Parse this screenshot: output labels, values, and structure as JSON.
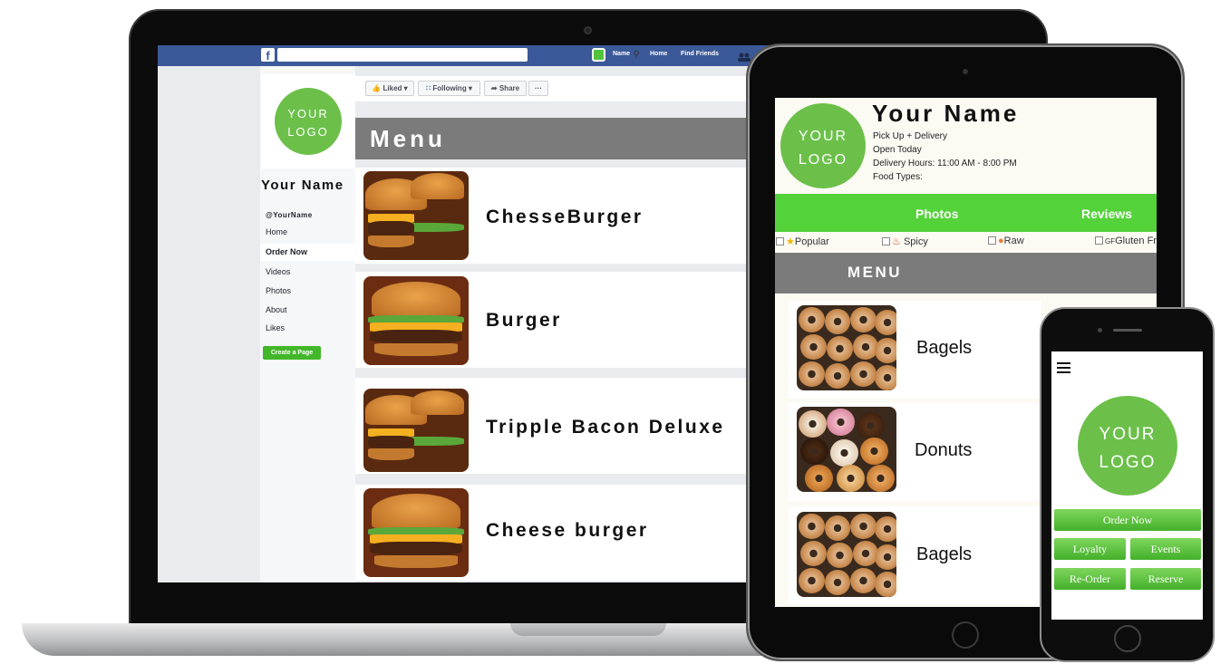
{
  "laptop": {
    "topbar": {
      "logo": "f",
      "search_placeholder": "",
      "search_icon": "search-icon",
      "nav_items": [
        "Name",
        "Home",
        "Find Friends"
      ]
    },
    "sidebar": {
      "logo_line1": "YOUR",
      "logo_line2": "LOGO",
      "page_name": "Your Name",
      "handle": "@YourName",
      "items": [
        "Home",
        "Order Now",
        "Videos",
        "Photos",
        "About",
        "Likes"
      ],
      "create_page": "Create a Page"
    },
    "actions": {
      "liked": "Liked ▾",
      "following": "Following ▾",
      "share": "Share",
      "more": "···"
    },
    "menu_title": "Menu",
    "menu_items": [
      "ChesseBurger",
      "Burger",
      "Tripple Bacon Deluxe",
      "Cheese burger"
    ]
  },
  "tablet": {
    "logo_line1": "YOUR",
    "logo_line2": "LOGO",
    "name": "Your Name",
    "info": [
      "Pick Up + Delivery",
      "Open Today",
      "Delivery Hours: 11:00 AM - 8:00 PM",
      "Food Types:"
    ],
    "tabs": [
      "Photos",
      "Reviews"
    ],
    "filters": [
      "Popular",
      "Spicy",
      "Raw",
      "Gluten Fr"
    ],
    "filter_prefix_gf": "GF",
    "menu_title": "MENU",
    "menu_items": [
      "Bagels",
      "Donuts",
      "Bagels"
    ]
  },
  "phone": {
    "logo_line1": "YOUR",
    "logo_line2": "LOGO",
    "buttons": {
      "order_now": "Order Now",
      "loyalty": "Loyalty",
      "events": "Events",
      "reorder": "Re-Order",
      "reserve": "Reserve"
    }
  },
  "colors": {
    "facebook_blue": "#3b5998",
    "brand_green": "#54d23a",
    "logo_green": "#6cc04a",
    "menu_gray": "#7b7b7b"
  }
}
